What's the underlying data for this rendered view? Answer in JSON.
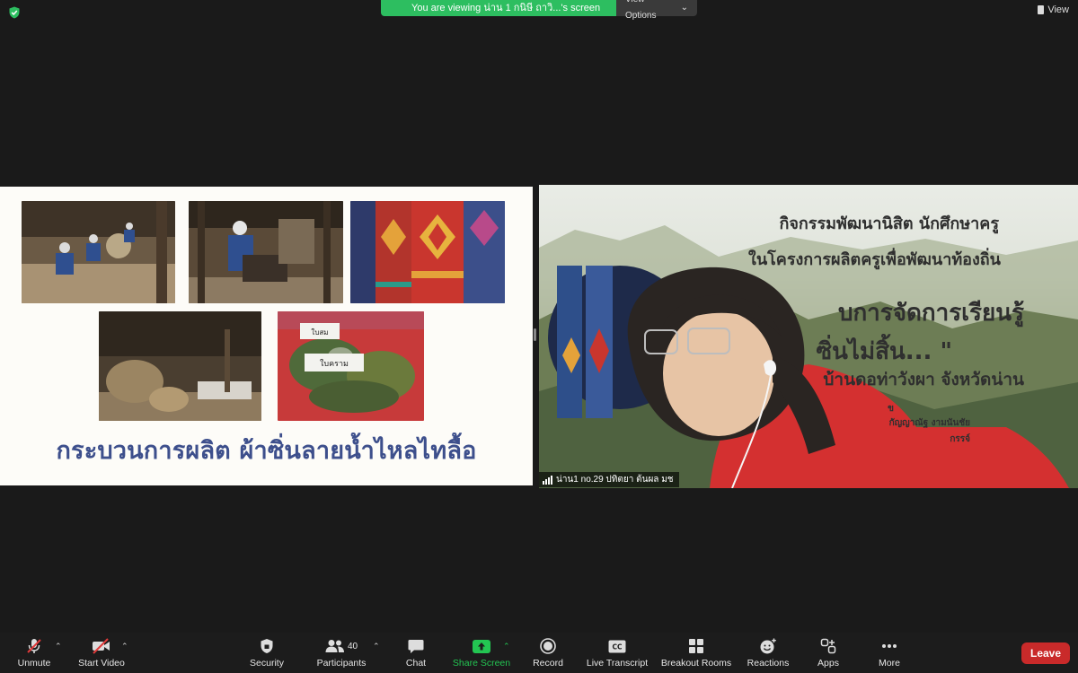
{
  "banner": {
    "message": "You are viewing น่าน 1 กนิษี ถาวิ...'s screen",
    "view_options": "View Options"
  },
  "top_right": {
    "view_label": "View"
  },
  "slide": {
    "title": "กระบวนการผลิต ผ้าซิ่นลายน้ำไหลไทลื้อ",
    "photo_labels": [
      "ใบสม",
      "ใบคราม"
    ]
  },
  "video": {
    "lines": [
      "กิจกรรมพัฒนานิสิต นักศึกษาครู",
      "ในโครงการผลิตครูเพื่อพัฒนาท้องถิ่น",
      "บการจัดการเรียนรู้",
      "ซิ่นไม่สิ้น... \"",
      "บ้านดอท่าวังผา จังหวัดน่าน",
      "ข",
      "กัญญาณัฐ งามนันชัย",
      "กรรจ์"
    ],
    "participant_name": "น่าน1 no.29 ปทิตยา ต้นผล มช"
  },
  "toolbar": {
    "unmute": "Unmute",
    "start_video": "Start Video",
    "security": "Security",
    "participants": "Participants",
    "participants_count": "40",
    "chat": "Chat",
    "share_screen": "Share Screen",
    "record": "Record",
    "live_transcript": "Live Transcript",
    "breakout_rooms": "Breakout Rooms",
    "reactions": "Reactions",
    "apps": "Apps",
    "more": "More",
    "leave": "Leave",
    "cc_label": "CC"
  },
  "colors": {
    "banner_green": "#2dbe60",
    "share_green": "#23c552",
    "leave_red": "#c92a2a",
    "title_blue": "#3d4f8c"
  }
}
